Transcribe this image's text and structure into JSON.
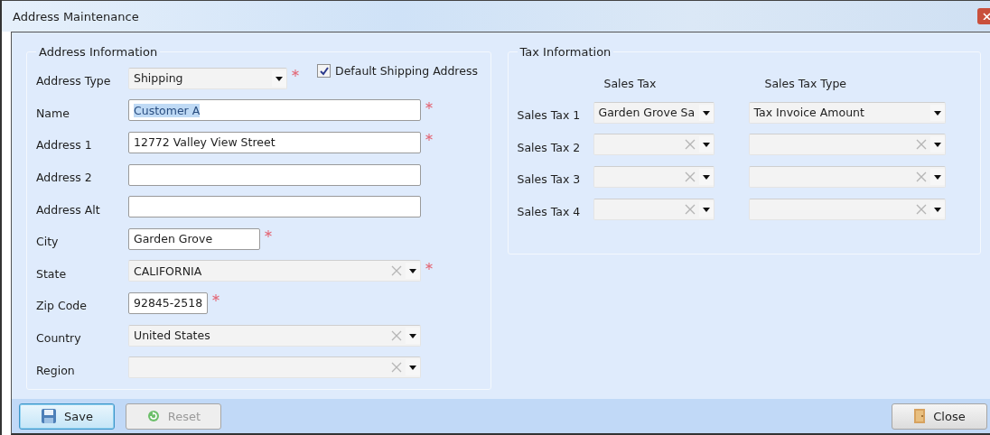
{
  "window": {
    "title": "Address Maintenance"
  },
  "address_information": {
    "title": "Address Information",
    "default_shipping": {
      "label": "Default Shipping Address",
      "checked": true
    },
    "fields": [
      {
        "kind": "select",
        "label": "Address Type",
        "value": "Shipping",
        "required": true,
        "text_selected": false
      },
      {
        "kind": "text",
        "label": "Name",
        "value": "Customer A",
        "required": true,
        "text_selected": true
      },
      {
        "kind": "text",
        "label": "Address 1",
        "value": "12772 Valley View Street",
        "required": true,
        "text_selected": false
      },
      {
        "kind": "text",
        "label": "Address 2",
        "required": false
      },
      {
        "kind": "text",
        "label": "Address Alt",
        "required": false
      },
      {
        "kind": "text",
        "label": "City",
        "value": "Garden Grove",
        "required": true,
        "text_selected": false
      },
      {
        "kind": "combo",
        "label": "State",
        "value": "CALIFORNIA",
        "required": true,
        "text_selected": false
      },
      {
        "kind": "text",
        "label": "Zip Code",
        "value": "92845-2518",
        "required": true,
        "text_selected": false
      },
      {
        "kind": "combo",
        "label": "Country",
        "value": "United States",
        "required": false,
        "text_selected": false
      },
      {
        "kind": "combo",
        "label": "Region",
        "required": false
      }
    ]
  },
  "tax_information": {
    "title": "Tax Information",
    "columns": [
      "Sales Tax",
      "Sales Tax Type"
    ],
    "rows": [
      {
        "label": "Sales Tax 1",
        "sales_tax": "Garden Grove Sa",
        "sales_tax_type": "Tax Invoice Amount"
      },
      {
        "label": "Sales Tax 2"
      },
      {
        "label": "Sales Tax 3"
      },
      {
        "label": "Sales Tax 4"
      }
    ]
  },
  "buttons": [
    {
      "kind": "save",
      "label": "Save",
      "disabled": false,
      "focused": true
    },
    {
      "kind": "reset",
      "label": "Reset",
      "disabled": true,
      "focused": false
    },
    {
      "kind": "close",
      "label": "Close",
      "disabled": false,
      "focused": false
    }
  ]
}
